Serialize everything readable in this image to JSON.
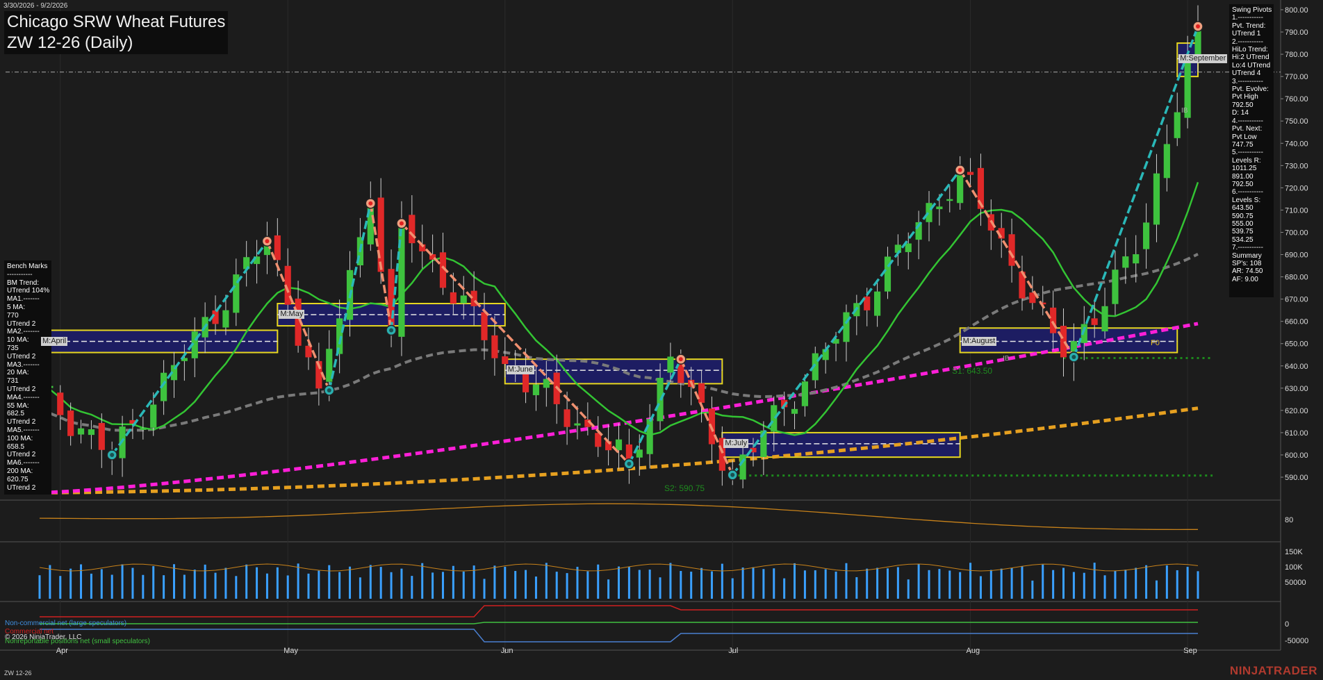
{
  "header": {
    "date_range": "3/30/2026 - 9/2/2026",
    "title": "Chicago SRW Wheat Futures",
    "subtitle": "ZW 12-26 (Daily)"
  },
  "bench_marks": [
    "Bench Marks",
    "-----------",
    "BM Trend:",
    "UTrend 104%",
    "MA1.-------",
    "5 MA:",
    "770",
    "UTrend 2",
    "MA2.-------",
    "10 MA:",
    "735",
    "UTrend 2",
    "MA3.-------",
    "20 MA:",
    "731",
    "UTrend 2",
    "MA4.-------",
    "55 MA:",
    "682.5",
    "UTrend 2",
    "MA5.-------",
    "100 MA:",
    "658.5",
    "UTrend 2",
    "MA6.-------",
    "200 MA:",
    "620.75",
    "UTrend 2"
  ],
  "swing_pivots": [
    "Swing Pivots",
    "1.-----------",
    "Pvt. Trend:",
    "UTrend 1",
    "2.-----------",
    "HiLo Trend:",
    "Hi:2 UTrend",
    "Lo:4 UTrend",
    "UTrend 4",
    "3.-----------",
    "Pvt. Evolve:",
    "Pvt High",
    "792.50",
    "D: 14",
    "4.-----------",
    "Pvt. Next:",
    "Pvt Low",
    "747.75",
    "5.-----------",
    "Levels R:",
    "1011.25",
    "891.00",
    "792.50",
    "6.-----------",
    "Levels S:",
    "643.50",
    "590.75",
    "555.00",
    "539.75",
    "534.25",
    "7.-----------",
    "Summary",
    "SP's: 108",
    "AR: 74.50",
    "AF: 9.00"
  ],
  "price_axis": [
    "800.00",
    "790.00",
    "780.00",
    "770.00",
    "760.00",
    "750.00",
    "740.00",
    "730.00",
    "720.00",
    "710.00",
    "700.00",
    "690.00",
    "680.00",
    "670.00",
    "660.00",
    "650.00",
    "640.00",
    "630.00",
    "620.00",
    "610.00",
    "600.00",
    "590.00"
  ],
  "x_axis": [
    "Apr",
    "May",
    "Jun",
    "Jul",
    "Aug",
    "Sep"
  ],
  "panel_labels": {
    "osc": "80",
    "vol": [
      "150K",
      "100K",
      "50000"
    ],
    "cot": [
      "0",
      "-50000"
    ]
  },
  "month_tags": [
    "M:April",
    "M:May",
    "M:June",
    "M:July",
    "M:August",
    "M:September"
  ],
  "levels": {
    "s1": "S1: 643.50",
    "s2": "S2: 590.75",
    "f0": "F0",
    "ib1": "IB",
    "ib2": "IB"
  },
  "cot_legend": {
    "noncommercial": "Non-commercial net (large speculators)",
    "commercial": "Commercial net",
    "copyright": "© 2026 NinjaTrader, LLC",
    "nonreportable": "Nonreportable positions net (small speculators)"
  },
  "footer": {
    "symbol": "ZW 12-26",
    "brand": "NINJATRADER"
  },
  "colors": {
    "background": "#1c1c1c",
    "up": "#3ec23e",
    "down": "#e02828",
    "ma_green": "#33c433",
    "ma_gray": "#7a7a7a",
    "ma_magenta": "#ff1fd8",
    "ma_orange": "#e6a020",
    "swing_up": "#2ab8b8",
    "swing_down": "#f09070",
    "volume": "#3aa0ff",
    "cot_large": "#4a7fd0",
    "cot_commercial": "#d02020",
    "cot_small": "#40c040"
  },
  "chart_data": {
    "type": "candlestick",
    "symbol": "ZW 12-26",
    "interval": "Daily",
    "ylim": [
      584,
      803
    ],
    "anchors": [
      {
        "d": "2026-03-30",
        "p": 628
      },
      {
        "d": "2026-04-08",
        "p": 600
      },
      {
        "d": "2026-04-29",
        "p": 697
      },
      {
        "d": "2026-05-06",
        "p": 630
      },
      {
        "d": "2026-05-13",
        "p": 714
      },
      {
        "d": "2026-05-15",
        "p": 656
      },
      {
        "d": "2026-05-18",
        "p": 705
      },
      {
        "d": "2026-06-01",
        "p": 641
      },
      {
        "d": "2026-06-17",
        "p": 596
      },
      {
        "d": "2026-06-23",
        "p": 644
      },
      {
        "d": "2026-07-01",
        "p": 591
      },
      {
        "d": "2026-07-31",
        "p": 728
      },
      {
        "d": "2026-08-14",
        "p": 644
      },
      {
        "d": "2026-08-25",
        "p": 690
      },
      {
        "d": "2026-09-02",
        "p": 793
      }
    ],
    "last_close": 778,
    "swing_points": [
      {
        "d": "2026-04-08",
        "p": 600,
        "type": "low"
      },
      {
        "d": "2026-04-29",
        "p": 696,
        "type": "high"
      },
      {
        "d": "2026-05-07",
        "p": 629,
        "type": "low"
      },
      {
        "d": "2026-05-13",
        "p": 713,
        "type": "high"
      },
      {
        "d": "2026-05-15",
        "p": 656,
        "type": "low"
      },
      {
        "d": "2026-05-18",
        "p": 704,
        "type": "high"
      },
      {
        "d": "2026-06-17",
        "p": 596,
        "type": "low"
      },
      {
        "d": "2026-06-24",
        "p": 643,
        "type": "high"
      },
      {
        "d": "2026-07-01",
        "p": 591,
        "type": "low"
      },
      {
        "d": "2026-07-31",
        "p": 728,
        "type": "high"
      },
      {
        "d": "2026-08-17",
        "p": 644,
        "type": "low"
      },
      {
        "d": "2026-09-02",
        "p": 792.5,
        "type": "high"
      }
    ],
    "moving_averages": [
      {
        "name": "20 MA",
        "value": 731,
        "start": 628
      },
      {
        "name": "55 MA",
        "value": 682.5,
        "start": 608
      },
      {
        "name": "100 MA",
        "value": 658.5,
        "start": 583
      },
      {
        "name": "200 MA",
        "value": 620.75,
        "start": 583
      }
    ],
    "support": [
      643.5,
      590.75
    ],
    "resistance": [
      792.5,
      891.0,
      1011.25
    ],
    "pivot_high": 792.5,
    "pivot_next_low": 747.75,
    "month_boxes": [
      {
        "label": "M:April",
        "top": 656,
        "bottom": 646,
        "from": "2026-03-30",
        "to": "2026-04-30",
        "mid": 651
      },
      {
        "label": "M:May",
        "top": 668,
        "bottom": 658,
        "from": "2026-04-30",
        "to": "2026-05-31",
        "mid": 663
      },
      {
        "label": "M:June",
        "top": 643,
        "bottom": 632,
        "from": "2026-05-31",
        "to": "2026-06-30",
        "mid": 638
      },
      {
        "label": "M:July",
        "top": 610,
        "bottom": 599,
        "from": "2026-06-30",
        "to": "2026-07-31",
        "mid": 605
      },
      {
        "label": "M:August",
        "top": 657,
        "bottom": 646,
        "from": "2026-07-31",
        "to": "2026-08-31",
        "mid": 651
      },
      {
        "label": "M:September",
        "top": 785,
        "bottom": 770,
        "from": "2026-08-31",
        "to": "2026-09-02",
        "mid": 778
      }
    ]
  }
}
